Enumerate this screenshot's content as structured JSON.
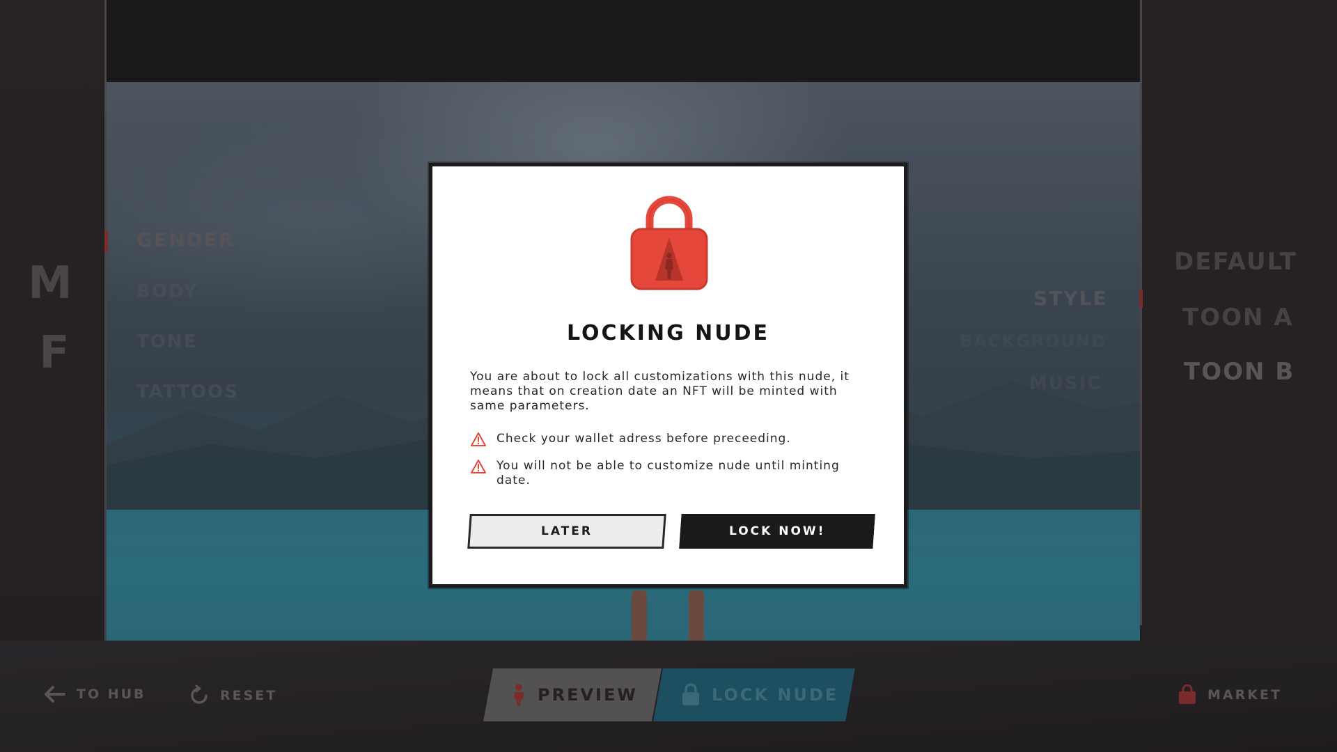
{
  "background": {
    "left_menu": {
      "letters": [
        "M",
        "F"
      ],
      "items": [
        "Gender",
        "Body",
        "Tone",
        "Tattoos"
      ]
    },
    "center_menu": {
      "items": [
        "Style",
        "Background",
        "Music"
      ]
    },
    "right_menu": {
      "items": [
        "Default",
        "Toon A",
        "Toon B"
      ]
    },
    "bottom_nav": {
      "to_hub": "To Hub",
      "reset": "Reset",
      "market": "Market"
    },
    "tabs": {
      "preview": "Preview",
      "lock_nude": "Lock Nude"
    }
  },
  "modal": {
    "icon": "padlock-icon",
    "title": "Locking Nude",
    "body": "You are about to lock all customizations with this nude, it means that on creation date an NFT will be minted with same parameters.",
    "warnings": [
      "Check your wallet adress before preceeding.",
      "You will not be able to customize nude until minting date."
    ],
    "later_label": "Later",
    "lock_label": "Lock now!"
  },
  "colors": {
    "accent_red": "#e5473a",
    "modal_bg": "#ffffff",
    "dark": "#1b191a",
    "lock_tab": "#1d4f60"
  }
}
